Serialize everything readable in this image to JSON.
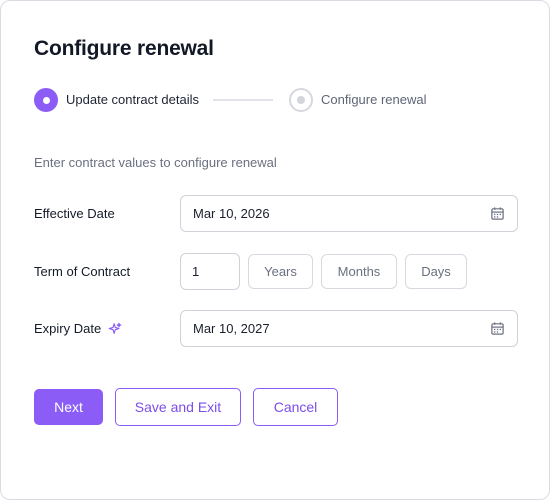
{
  "dialog": {
    "title": "Configure renewal",
    "subtitle": "Enter contract values to configure renewal"
  },
  "stepper": {
    "steps": [
      {
        "label": "Update contract details",
        "state": "active"
      },
      {
        "label": "Configure renewal",
        "state": "inactive"
      }
    ]
  },
  "form": {
    "effective_date": {
      "label": "Effective Date",
      "value": "Mar 10, 2026",
      "icon": "calendar-icon"
    },
    "term": {
      "label": "Term of Contract",
      "value": "1",
      "units": [
        "Years",
        "Months",
        "Days"
      ]
    },
    "expiry_date": {
      "label": "Expiry Date",
      "value": "Mar 10, 2027",
      "icon": "calendar-icon",
      "badge_icon": "sparkle-icon"
    }
  },
  "actions": {
    "next": "Next",
    "save_exit": "Save and Exit",
    "cancel": "Cancel"
  },
  "colors": {
    "accent": "#8b5cf6",
    "border": "#cfd2d9",
    "muted_text": "#6b7080"
  }
}
